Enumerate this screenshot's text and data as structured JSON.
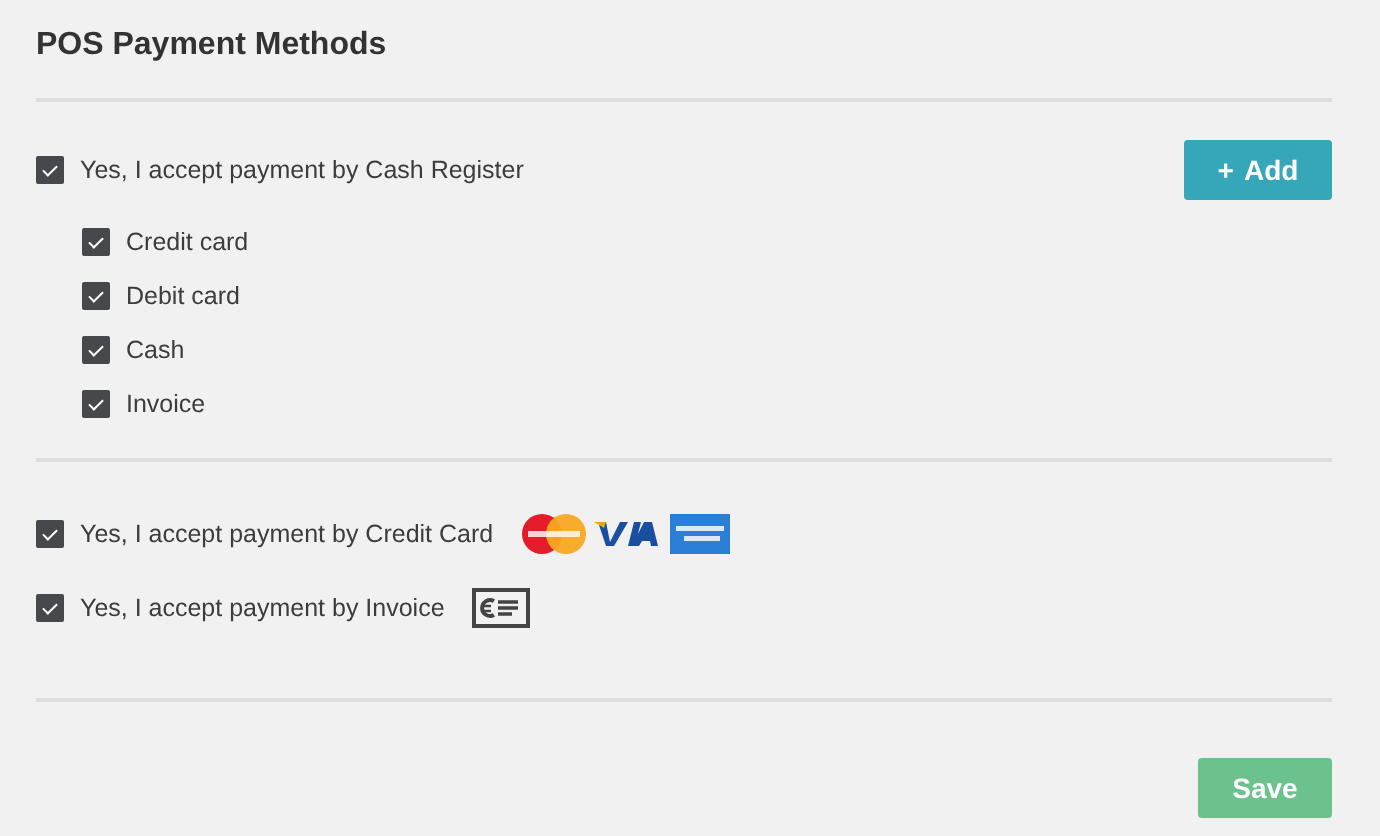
{
  "title": "POS Payment Methods",
  "cash_register": {
    "label": "Yes, I accept payment by Cash Register",
    "checked": true,
    "add_button": {
      "icon": "+",
      "label": "Add"
    },
    "children": [
      {
        "label": "Credit card",
        "checked": true
      },
      {
        "label": "Debit card",
        "checked": true
      },
      {
        "label": "Cash",
        "checked": true
      },
      {
        "label": "Invoice",
        "checked": true
      }
    ]
  },
  "other_methods": [
    {
      "kind": "cards",
      "label": "Yes, I accept payment by Credit Card",
      "checked": true
    },
    {
      "kind": "invoice",
      "label": "Yes, I accept payment by Invoice",
      "checked": true
    }
  ],
  "save_button": {
    "label": "Save"
  }
}
